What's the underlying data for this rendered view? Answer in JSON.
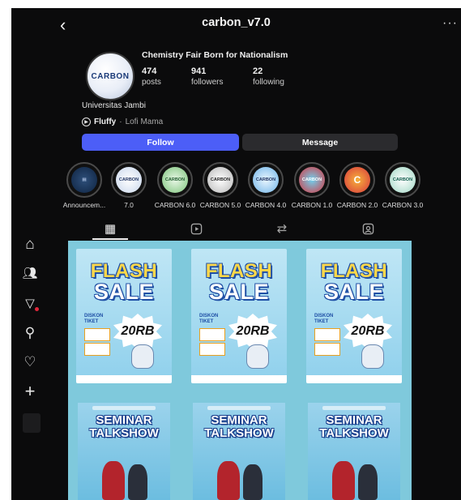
{
  "header": {
    "back_icon": "chevron-left-icon",
    "username": "carbon_v7.0",
    "more_label": "···"
  },
  "profile": {
    "avatar_text": "CARBON",
    "name": "Chemistry Fair Born for Nationalism",
    "stats": [
      {
        "value": "474",
        "label": "posts"
      },
      {
        "value": "941",
        "label": "followers"
      },
      {
        "value": "22",
        "label": "following"
      }
    ],
    "bio": "Universitas Jambi",
    "music": {
      "title": "Fluffy",
      "separator": "·",
      "artist": "Lofi Mama"
    }
  },
  "actions": {
    "follow": "Follow",
    "message": "Message"
  },
  "highlights": [
    {
      "label": "Announcem..."
    },
    {
      "label": "7.0"
    },
    {
      "label": "CARBON 6.0"
    },
    {
      "label": "CARBON 5.0"
    },
    {
      "label": "CARBON 4.0"
    },
    {
      "label": "CARBON 1.0"
    },
    {
      "label": "CARBON 2.0"
    },
    {
      "label": "CARBON 3.0"
    }
  ],
  "tabs": [
    "grid-icon",
    "reels-icon",
    "reposts-icon",
    "tagged-icon"
  ],
  "posts": {
    "flash": {
      "line1": "FLASH",
      "line2": "SALE",
      "diskon": "DISKON TIKET",
      "price": "20RB"
    },
    "seminar": {
      "line1": "SEMINAR",
      "line2": "TALKSHOW"
    }
  },
  "nav": [
    "home-icon",
    "people-icon",
    "messages-icon",
    "search-icon",
    "heart-icon",
    "plus-icon"
  ],
  "colors": {
    "follow": "#4c5ef7",
    "message": "#2b2b2e",
    "grid_bg": "#7fc9dc",
    "background": "#0b0b0c"
  }
}
